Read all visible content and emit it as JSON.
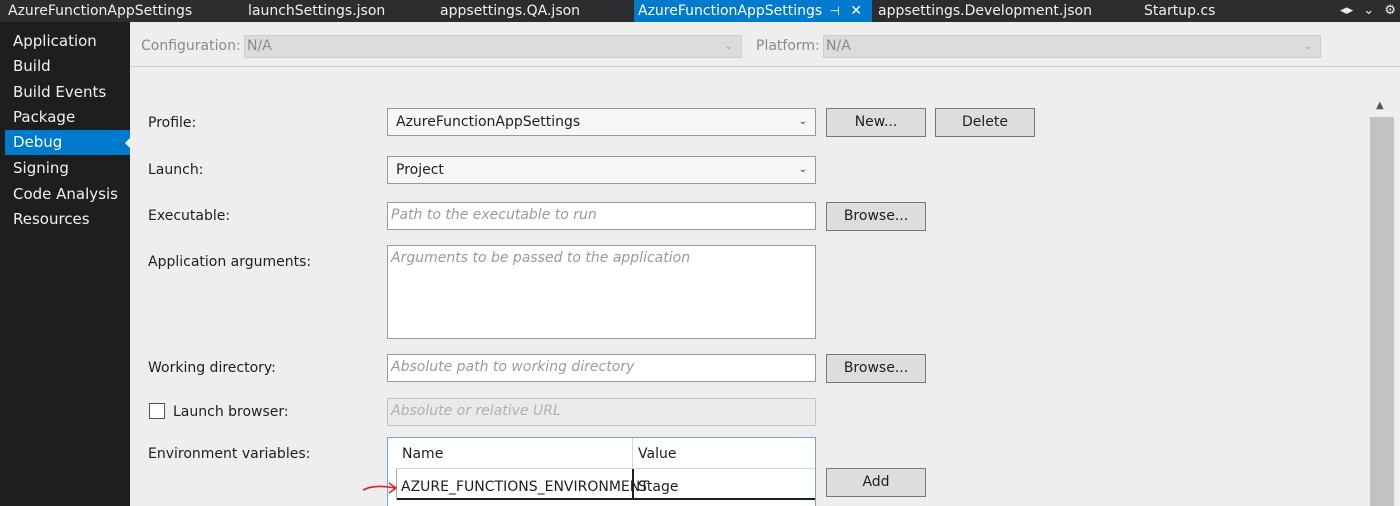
{
  "tabs": [
    {
      "label": "AzureFunctionAppSettings",
      "active": false
    },
    {
      "label": "launchSettings.json",
      "active": false
    },
    {
      "label": "appsettings.QA.json",
      "active": false
    },
    {
      "label": "AzureFunctionAppSettings",
      "active": true
    },
    {
      "label": "appsettings.Development.json",
      "active": false
    },
    {
      "label": "Startup.cs",
      "active": false
    }
  ],
  "sidebar": {
    "items": [
      {
        "label": "Application"
      },
      {
        "label": "Build"
      },
      {
        "label": "Build Events"
      },
      {
        "label": "Package"
      },
      {
        "label": "Debug",
        "active": true
      },
      {
        "label": "Signing"
      },
      {
        "label": "Code Analysis"
      },
      {
        "label": "Resources"
      }
    ]
  },
  "config": {
    "configuration_label": "Configuration:",
    "configuration_value": "N/A",
    "platform_label": "Platform:",
    "platform_value": "N/A"
  },
  "form": {
    "profile_label": "Profile:",
    "profile_value": "AzureFunctionAppSettings",
    "new_button": "New...",
    "delete_button": "Delete",
    "launch_label": "Launch:",
    "launch_value": "Project",
    "executable_label": "Executable:",
    "executable_placeholder": "Path to the executable to run",
    "browse_button": "Browse...",
    "args_label": "Application arguments:",
    "args_placeholder": "Arguments to be passed to the application",
    "workdir_label": "Working directory:",
    "workdir_placeholder": "Absolute path to working directory",
    "launch_browser_label": "Launch browser:",
    "url_placeholder": "Absolute or relative URL",
    "env_label": "Environment variables:",
    "env_columns": {
      "name": "Name",
      "value": "Value"
    },
    "env_rows": [
      {
        "name": "AZURE_FUNCTIONS_ENVIRONMENT",
        "value": "Stage"
      }
    ],
    "add_button": "Add"
  },
  "colors": {
    "accent": "#007acc",
    "sidebar_bg": "#1e1e1e",
    "annotation_arrow": "#e02020"
  },
  "icons": {
    "pin": "pin-icon",
    "close": "close-icon",
    "dropdown": "chevron-down-icon",
    "settings": "gear-icon"
  }
}
